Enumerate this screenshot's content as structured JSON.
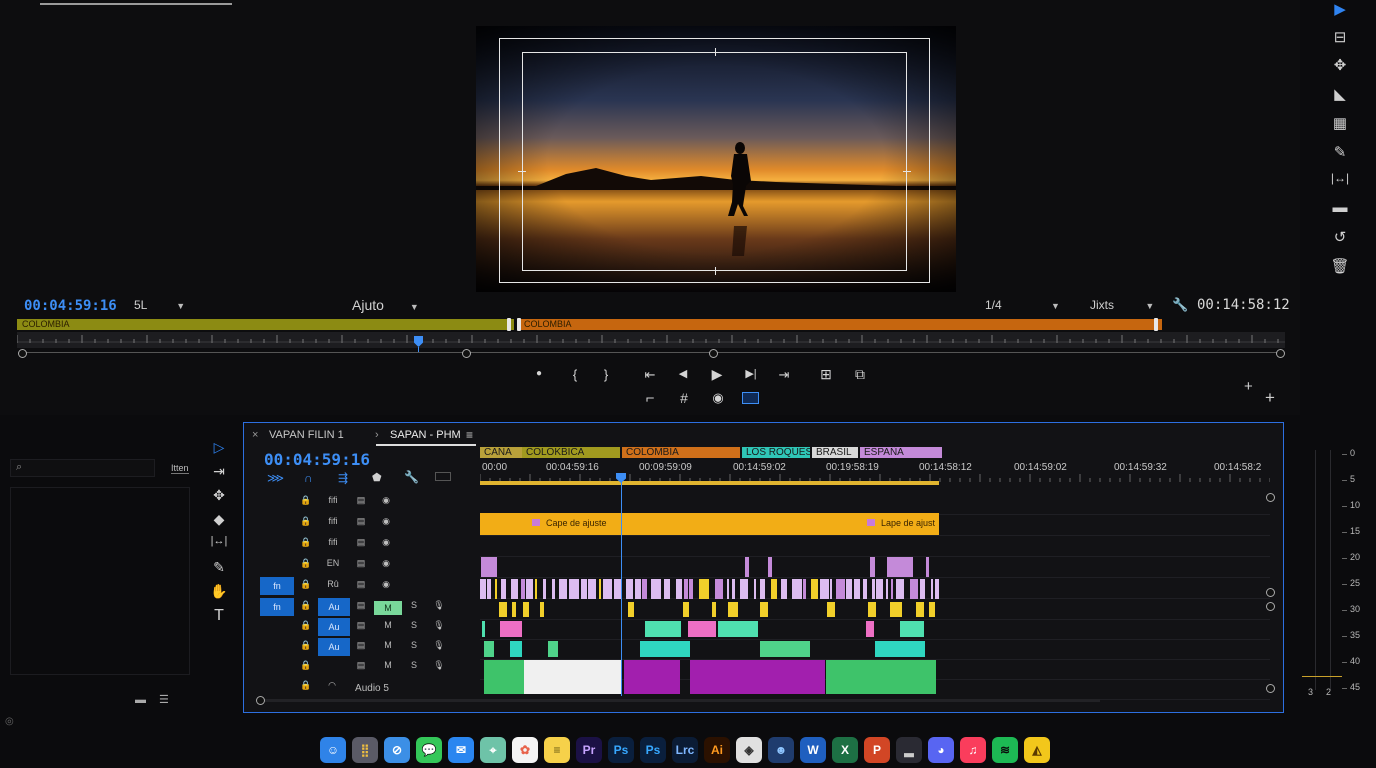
{
  "program_monitor": {
    "timecode": "00:04:59:16",
    "in_dropdown": "5L",
    "fit_dropdown": "Ajuto",
    "resolution_dropdown": "1/4",
    "quality_dropdown": "Jixts",
    "duration_timecode": "00:14:58:12",
    "clip_bar_labels": [
      "COLOMBIA",
      "COLOMBIA"
    ],
    "clip_bar_colors": [
      "#8c8b13",
      "#c6660f"
    ]
  },
  "transport": {
    "row1": [
      "●",
      "{",
      "}",
      "⇤",
      "◀",
      "▶",
      "▶|",
      "⇥",
      "⊞",
      "⧉"
    ],
    "row2": [
      "⌐",
      "#",
      "◉",
      "▭"
    ]
  },
  "timeline": {
    "tabs": [
      {
        "close": "×",
        "label": "VAPAN FILIN 1"
      },
      {
        "close": "›",
        "label": "SAPAN - PHM"
      }
    ],
    "menu_glyph": "≡",
    "timecode": "00:04:59:16",
    "sequence_segments": [
      {
        "label": "CANA",
        "color": "#b9a13a"
      },
      {
        "label": "COLOKBICA",
        "color": "#a19a1f"
      },
      {
        "label": "COLOMBIA",
        "color": "#d0701a"
      },
      {
        "label": "LOS ROQUES",
        "color": "#2fc6b7"
      },
      {
        "label": "BRASIL",
        "color": "#d8d8d8"
      },
      {
        "label": "ESPAÑA",
        "color": "#c48ad9"
      }
    ],
    "ruler_labels": [
      "00:00",
      "00:04:59:16",
      "00:09:59:09",
      "00:14:59:02",
      "00:19:58:19",
      "00:14:58:12",
      "00:14:59:02",
      "00:14:59:32",
      "00:14:58:2"
    ],
    "adjustment_layers": [
      "Cape de ajuste",
      "Lape de ajust"
    ],
    "tracks": [
      {
        "lock": "🔒",
        "name": "fifi",
        "eye": "◉",
        "type": "video"
      },
      {
        "lock": "🔒",
        "name": "fifi",
        "eye": "◉",
        "type": "video"
      },
      {
        "lock": "🔒",
        "name": "fifi",
        "eye": "◉",
        "type": "video"
      },
      {
        "lock": "🔒",
        "name": "EN",
        "eye": "◉",
        "type": "video"
      },
      {
        "lock": "🔒",
        "name": "Rû",
        "eye": "◉",
        "type": "video",
        "src": "fn"
      },
      {
        "lock": "🔒",
        "name": "Au",
        "m": "M",
        "s": "S",
        "mic": "🎙",
        "type": "audio",
        "src": "fn",
        "m_active": true
      },
      {
        "lock": "🔒",
        "name": "Au",
        "m": "M",
        "s": "S",
        "mic": "🎙",
        "type": "audio"
      },
      {
        "lock": "🔒",
        "name": "Au",
        "m": "M",
        "s": "S",
        "mic": "🎙",
        "type": "audio"
      },
      {
        "lock": "🔒",
        "name": "",
        "m": "M",
        "s": "S",
        "mic": "🎙",
        "type": "audio"
      },
      {
        "lock": "🔒",
        "name": "Audio 5",
        "type": "audio"
      }
    ]
  },
  "project_panel": {
    "search_icon": "⌕",
    "filter_label": "Itten"
  },
  "audio_meter": {
    "scale": [
      "0",
      "5",
      "10",
      "15",
      "20",
      "25",
      "30",
      "35",
      "40",
      "45"
    ],
    "channels": [
      "3",
      "2"
    ]
  },
  "dock": {
    "apps": [
      {
        "name": "Finder",
        "label": "☺",
        "bg": "#2f83e8",
        "fg": "#ffffff"
      },
      {
        "name": "Launchpad",
        "label": "⣿",
        "bg": "#5a5a66",
        "fg": "#f0c040"
      },
      {
        "name": "Safari",
        "label": "⊘",
        "bg": "#3c8fe6",
        "fg": "#ffffff"
      },
      {
        "name": "Messages",
        "label": "💬",
        "bg": "#34c759",
        "fg": "#ffffff"
      },
      {
        "name": "Mail",
        "label": "✉",
        "bg": "#2a86f0",
        "fg": "#ffffff"
      },
      {
        "name": "Maps",
        "label": "⌖",
        "bg": "#6ec3a8",
        "fg": "#ffffff"
      },
      {
        "name": "Photos",
        "label": "✿",
        "bg": "#f4f4f4",
        "fg": "#e8624a"
      },
      {
        "name": "Notes",
        "label": "≡",
        "bg": "#f6d14a",
        "fg": "#6b5a12"
      },
      {
        "name": "Premiere Pro",
        "label": "Pr",
        "bg": "#1b1145",
        "fg": "#c7a4ff"
      },
      {
        "name": "Photoshop",
        "label": "Ps",
        "bg": "#0a1f3d",
        "fg": "#37a8ff"
      },
      {
        "name": "Photoshop Express",
        "label": "Ps",
        "bg": "#0a1f3d",
        "fg": "#37a8ff"
      },
      {
        "name": "Lightroom Classic",
        "label": "Lrc",
        "bg": "#0b1c35",
        "fg": "#7fb7ff"
      },
      {
        "name": "Illustrator",
        "label": "Ai",
        "bg": "#2b1100",
        "fg": "#ff9a1f"
      },
      {
        "name": "DaVinci Resolve",
        "label": "◈",
        "bg": "#e0e0e0",
        "fg": "#333333"
      },
      {
        "name": "Finder Alt",
        "label": "☻",
        "bg": "#1f3c6e",
        "fg": "#8ec5ff"
      },
      {
        "name": "Word",
        "label": "W",
        "bg": "#1f5fbf",
        "fg": "#ffffff"
      },
      {
        "name": "Excel",
        "label": "X",
        "bg": "#1d7044",
        "fg": "#ffffff"
      },
      {
        "name": "PowerPoint",
        "label": "P",
        "bg": "#d24625",
        "fg": "#ffffff"
      },
      {
        "name": "Terminal",
        "label": "▂",
        "bg": "#2a2a33",
        "fg": "#cccccc"
      },
      {
        "name": "Discord",
        "label": "◕",
        "bg": "#5865f2",
        "fg": "#ffffff"
      },
      {
        "name": "Music",
        "label": "♫",
        "bg": "#fa3d5c",
        "fg": "#ffffff"
      },
      {
        "name": "Spotify",
        "label": "≋",
        "bg": "#1db954",
        "fg": "#0b0b0b"
      },
      {
        "name": "Shortcuts",
        "label": "◭",
        "bg": "#f2c71b",
        "fg": "#5a3a00"
      }
    ]
  }
}
